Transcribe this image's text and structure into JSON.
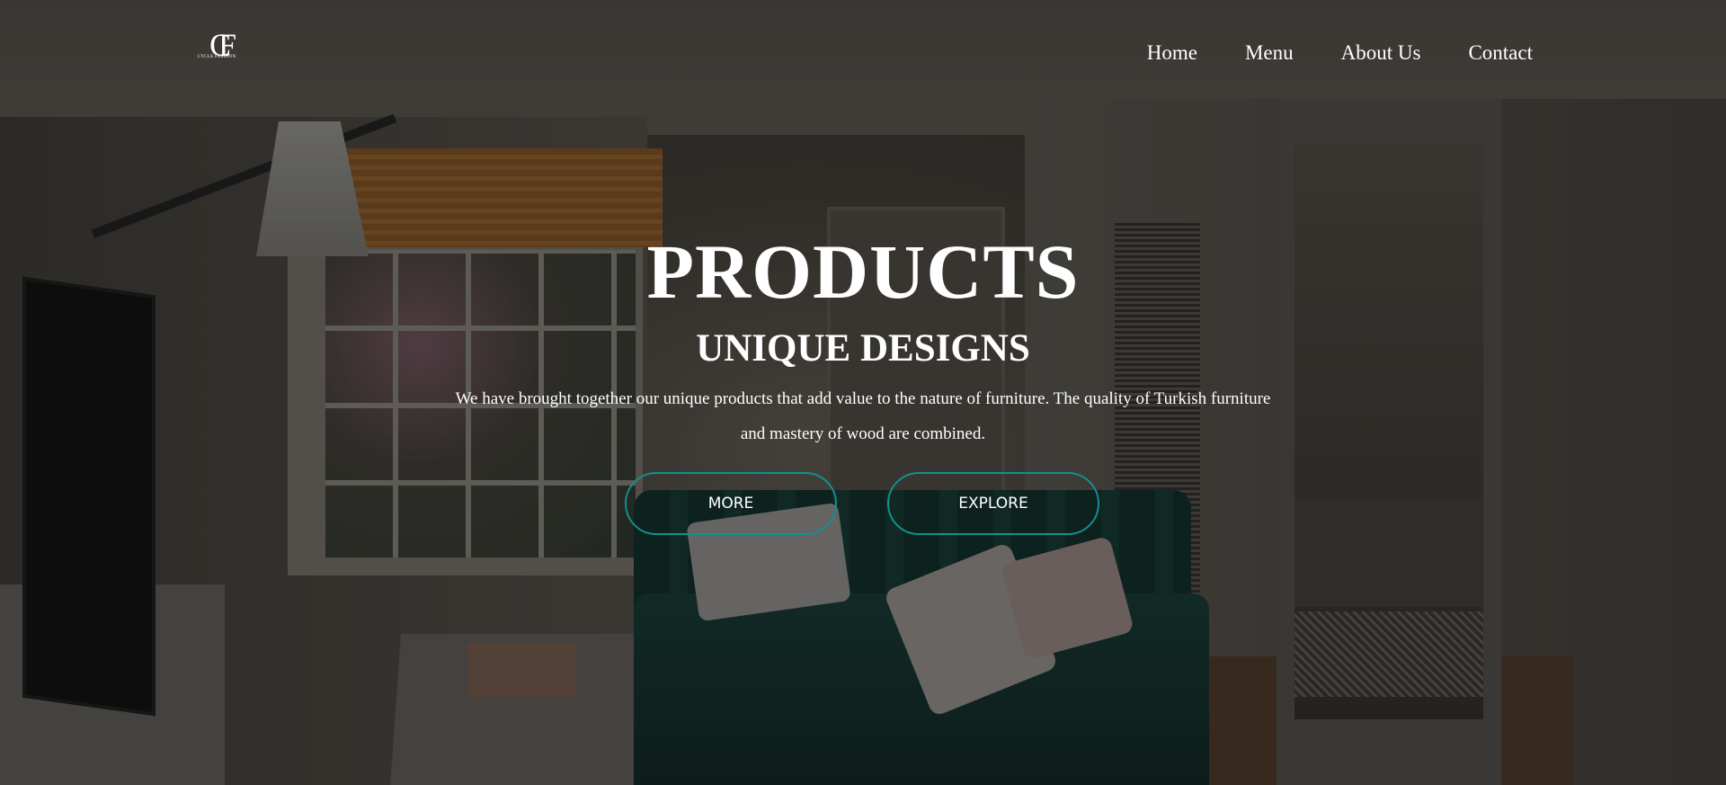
{
  "header": {
    "logo_mark": "CF",
    "logo_text": "CYCLE FASHION",
    "nav": [
      {
        "label": "Home"
      },
      {
        "label": "Menu"
      },
      {
        "label": "About Us"
      },
      {
        "label": "Contact"
      }
    ]
  },
  "hero": {
    "title": "PRODUCTS",
    "subtitle": "UNIQUE DESIGNS",
    "description": "We have brought together our unique products that add value to the nature of furniture. The quality of Turkish furniture and mastery of wood are combined.",
    "buttons": {
      "more_label": "MORE",
      "explore_label": "EXPLORE"
    }
  },
  "colors": {
    "button_border": "#138f8f",
    "text": "#ffffff"
  }
}
